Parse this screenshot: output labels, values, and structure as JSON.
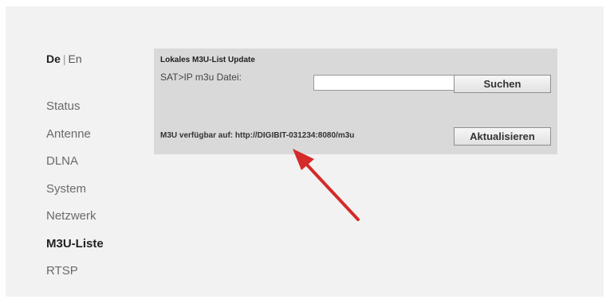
{
  "language": {
    "active": "De",
    "separator": "|",
    "other": "En"
  },
  "nav": {
    "items": [
      {
        "label": "Status"
      },
      {
        "label": "Antenne"
      },
      {
        "label": "DLNA"
      },
      {
        "label": "System"
      },
      {
        "label": "Netzwerk"
      },
      {
        "label": "M3U-Liste"
      },
      {
        "label": "RTSP"
      }
    ],
    "active_item": "M3U-Liste"
  },
  "panel": {
    "title": "Lokales M3U-List Update",
    "file_label": "SAT>IP m3u Datei:",
    "file_value": "",
    "search_button": "Suchen",
    "status_text": "M3U verfügbar auf: http://DIGIBIT-031234:8080/m3u",
    "update_button": "Aktualisieren"
  },
  "colors": {
    "background": "#f2f2f2",
    "panel": "#d9d9d9",
    "arrow": "#d42a2a"
  }
}
